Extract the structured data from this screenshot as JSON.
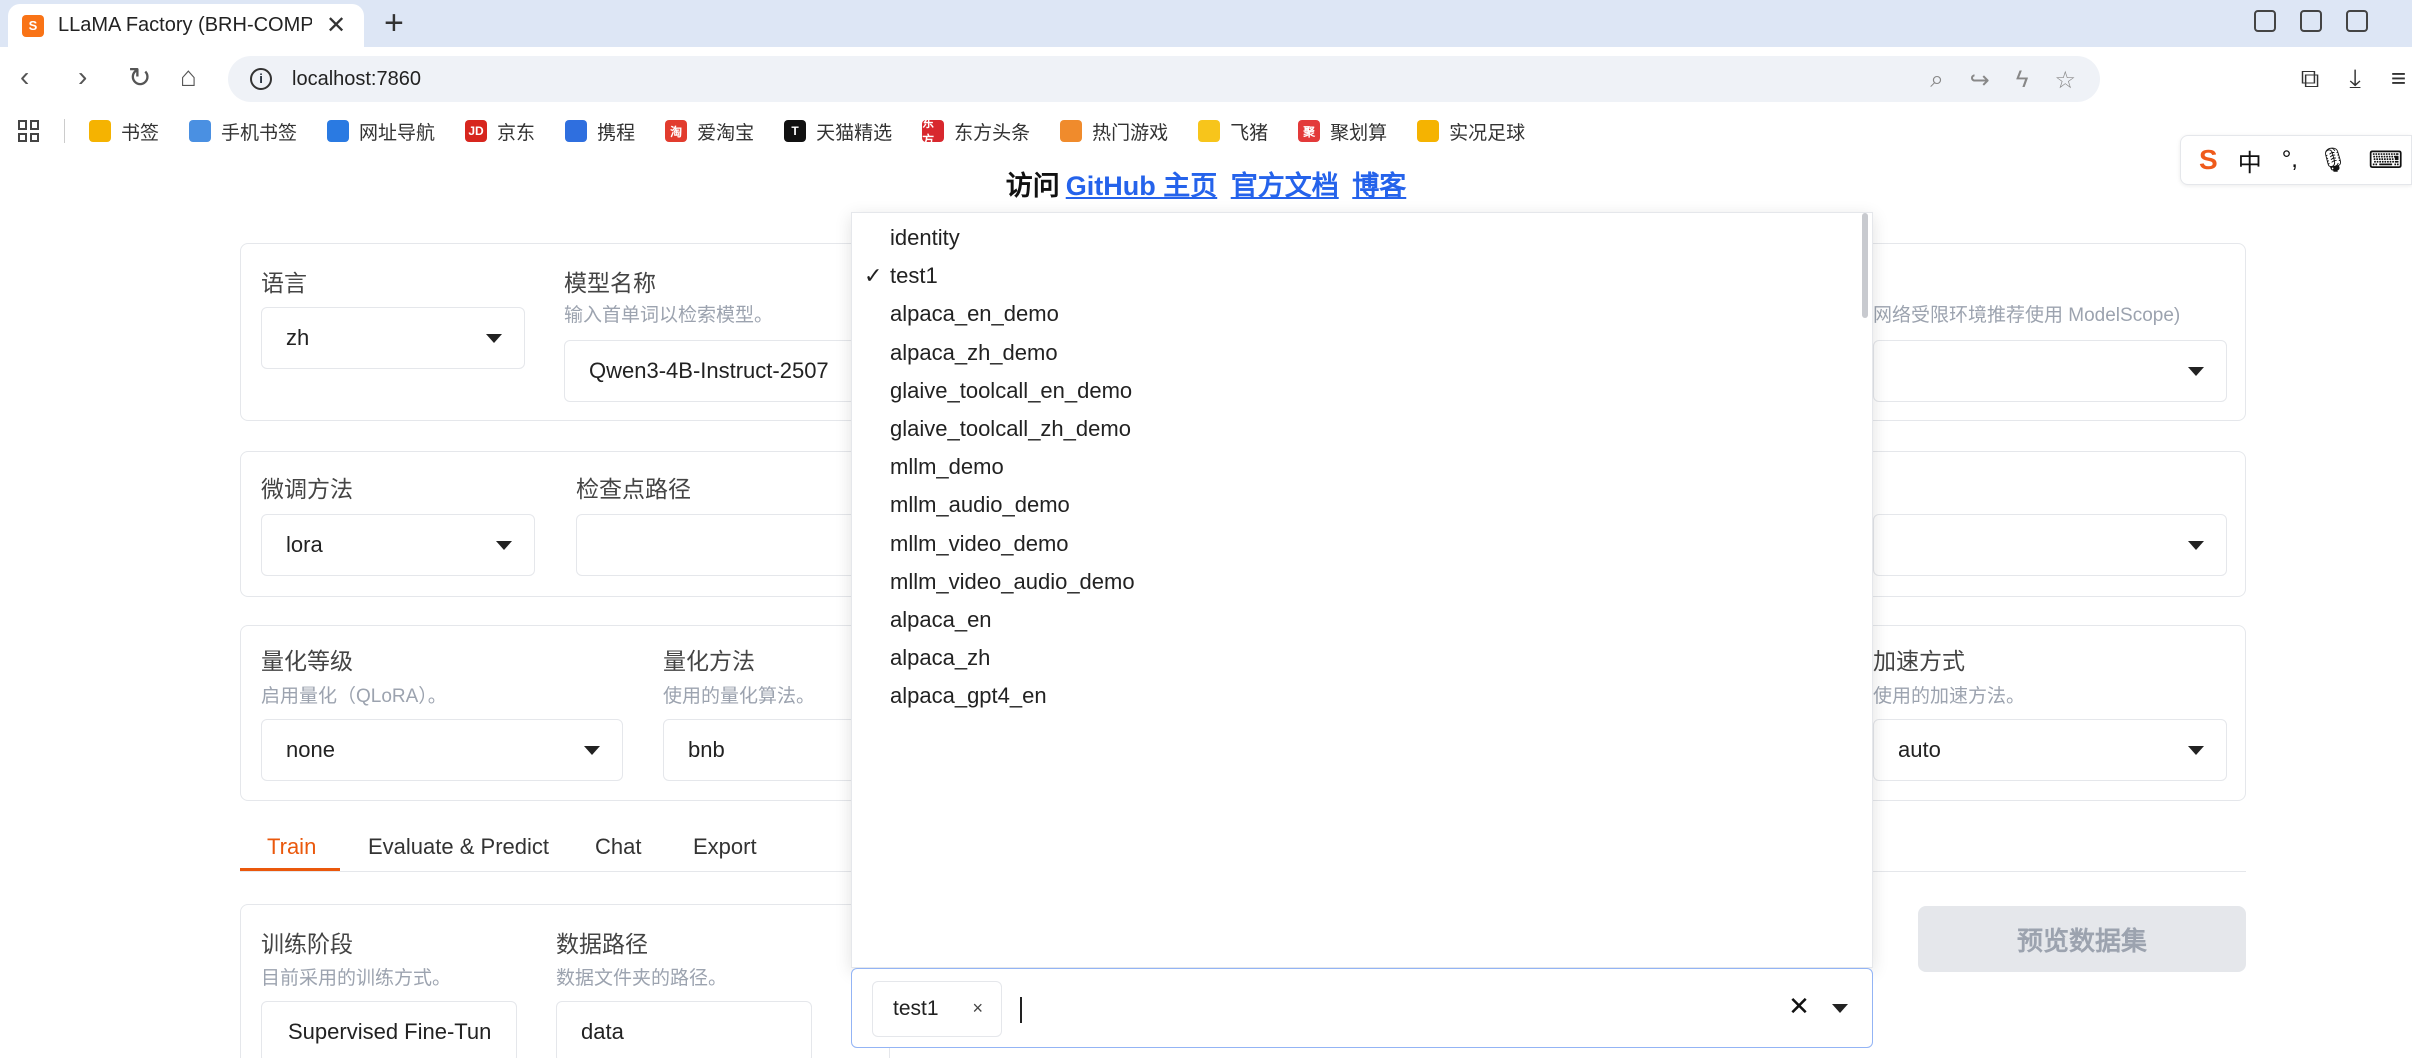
{
  "browser": {
    "tab_title": "LLaMA Factory (BRH-COMPU",
    "tab_favicon": "S",
    "url": "localhost:7860"
  },
  "bookmarks": [
    {
      "label": "书签",
      "icon": "star-icon",
      "color": "#f5b301"
    },
    {
      "label": "手机书签",
      "icon": "phone-icon",
      "color": "#4a90e2"
    },
    {
      "label": "网址导航",
      "icon": "nav-icon",
      "color": "#2a7ae2"
    },
    {
      "label": "京东",
      "icon": "JD",
      "color": "#d7261e"
    },
    {
      "label": "携程",
      "icon": "ctrip-icon",
      "color": "#2f6fdf"
    },
    {
      "label": "爱淘宝",
      "icon": "淘",
      "color": "#e23c2e"
    },
    {
      "label": "天猫精选",
      "icon": "T",
      "color": "#111111"
    },
    {
      "label": "东方头条",
      "icon": "东方",
      "color": "#d8282e"
    },
    {
      "label": "热门游戏",
      "icon": "game-icon",
      "color": "#f08b2c"
    },
    {
      "label": "飞猪",
      "icon": "fliggy-icon",
      "color": "#f7c51b"
    },
    {
      "label": "聚划算",
      "icon": "聚",
      "color": "#e33a3a"
    },
    {
      "label": "实况足球",
      "icon": "folder-icon",
      "color": "#f5b301"
    }
  ],
  "ime": {
    "logo": "S",
    "mode": "中",
    "punct": "°,"
  },
  "header": {
    "prefix": "访问",
    "links": [
      "GitHub 主页",
      "官方文档",
      "博客"
    ]
  },
  "row1": {
    "lang_label": "语言",
    "lang_value": "zh",
    "model_label": "模型名称",
    "model_hint": "输入首单词以检索模型。",
    "model_value": "Qwen3-4B-Instruct-2507",
    "hub_hint_partial": "网络受限环境推荐使用 ModelScope)"
  },
  "row2": {
    "method_label": "微调方法",
    "method_value": "lora",
    "ckpt_label": "检查点路径",
    "ckpt_value": ""
  },
  "row3": {
    "quant_label": "量化等级",
    "quant_hint": "启用量化（QLoRA）。",
    "quant_value": "none",
    "qmethod_label": "量化方法",
    "qmethod_hint": "使用的量化算法。",
    "qmethod_value": "bnb",
    "accel_label_partial": "加速方式",
    "accel_hint_partial": "使用的加速方法。",
    "accel_value": "auto"
  },
  "tabs": [
    "Train",
    "Evaluate & Predict",
    "Chat",
    "Export"
  ],
  "train": {
    "stage_label": "训练阶段",
    "stage_hint": "目前采用的训练方式。",
    "stage_value": "Supervised Fine-Tuni",
    "datadir_label": "数据路径",
    "datadir_hint": "数据文件夹的路径。",
    "datadir_value": "data",
    "preview_button": "预览数据集"
  },
  "dataset_dropdown": {
    "options": [
      "identity",
      "test1",
      "alpaca_en_demo",
      "alpaca_zh_demo",
      "glaive_toolcall_en_demo",
      "glaive_toolcall_zh_demo",
      "mllm_demo",
      "mllm_audio_demo",
      "mllm_video_demo",
      "mllm_video_audio_demo",
      "alpaca_en",
      "alpaca_zh",
      "alpaca_gpt4_en"
    ],
    "checked": "test1",
    "check_mark": "✓",
    "selected_chips": [
      "test1"
    ],
    "chip_remove": "×",
    "clear_symbol": "✕"
  }
}
